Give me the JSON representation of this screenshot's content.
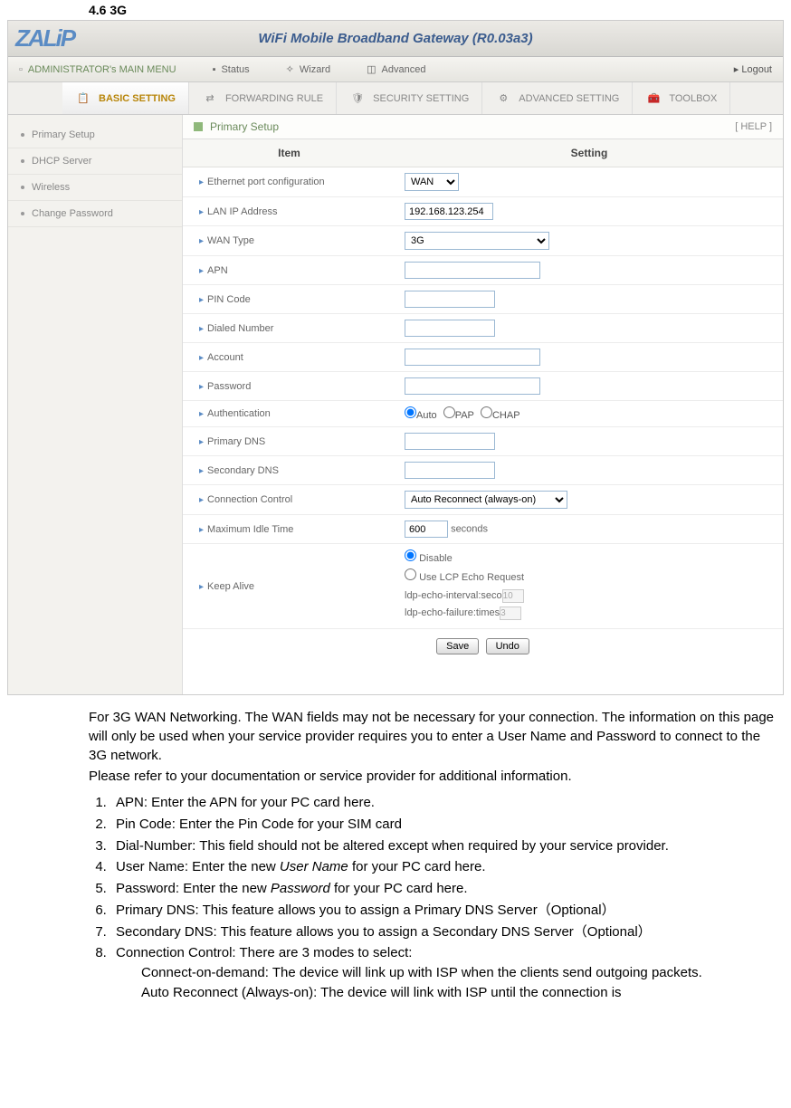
{
  "section_title": "4.6 3G",
  "header": {
    "logo_text": "ZALiP",
    "title": "WiFi Mobile Broadband Gateway (R0.03a3)"
  },
  "top_menu": {
    "admin": "ADMINISTRATOR's MAIN MENU",
    "status": "Status",
    "wizard": "Wizard",
    "advanced": "Advanced",
    "logout": "Logout"
  },
  "tabs": {
    "basic": "BASIC SETTING",
    "forwarding": "FORWARDING RULE",
    "security": "SECURITY SETTING",
    "advanced": "ADVANCED SETTING",
    "toolbox": "TOOLBOX"
  },
  "sidebar": {
    "items": [
      "Primary Setup",
      "DHCP Server",
      "Wireless",
      "Change Password"
    ]
  },
  "panel": {
    "title": "Primary Setup",
    "help": "[ HELP ]",
    "headers": {
      "item": "Item",
      "setting": "Setting"
    },
    "rows": {
      "eth_port": "Ethernet port configuration",
      "lan_ip": "LAN IP Address",
      "wan_type": "WAN Type",
      "apn": "APN",
      "pin": "PIN Code",
      "dialed": "Dialed Number",
      "account": "Account",
      "password": "Password",
      "auth": "Authentication",
      "pdns": "Primary DNS",
      "sdns": "Secondary DNS",
      "conn_ctrl": "Connection Control",
      "max_idle": "Maximum Idle Time",
      "keep_alive": "Keep Alive"
    },
    "values": {
      "eth_port": "WAN",
      "lan_ip": "192.168.123.254",
      "wan_type": "3G",
      "max_idle": "600",
      "max_idle_unit": "seconds",
      "conn_ctrl": "Auto Reconnect (always-on)"
    },
    "auth": {
      "auto": "Auto",
      "pap": "PAP",
      "chap": "CHAP"
    },
    "keep_alive": {
      "disable": "Disable",
      "lcp": "Use LCP Echo Request",
      "interval_label": "ldp-echo-interval:seco",
      "interval_val": "10",
      "failure_label": "ldp-echo-failure:times",
      "failure_val": "3"
    },
    "buttons": {
      "save": "Save",
      "undo": "Undo"
    }
  },
  "doc": {
    "p1": "For 3G WAN Networking. The WAN fields may not be necessary for your connection. The information on this page will only be used when your service provider requires you to enter a User Name and Password to connect to the 3G network.",
    "p2": "Please refer to your documentation or service provider for additional information.",
    "li1": "APN: Enter the APN for your PC card here.",
    "li2a": "Pin Code: Enter ",
    "li2b": "the Pin Code for your SIM card",
    "li3a": "Dial-Number: Th",
    "li3b": "is field should not be altered except when required by your service provider.",
    "li4a": "User Name: Enter the new ",
    "li4b": "User Name",
    "li4c": " for y",
    "li4d": "our PC card here.",
    "li5a": "Password: Enter the ",
    "li5b": "new ",
    "li5c": "Password",
    "li5d": " for your PC card here.",
    "li6": "Primary DNS: This feature allows you to assign a Primary DNS Server（Optional）",
    "li7": "Secondary DNS: This feature allows you to assign a Secondary DNS Server（Optional）",
    "li8": "Connection Control: There are 3 modes to select:",
    "li8a": "Connect-on-demand: The device will link up with ISP when the clients send outgoing packets.",
    "li8b": "Auto Reconnect (Always-on): The device will link with ISP until the connection is"
  }
}
